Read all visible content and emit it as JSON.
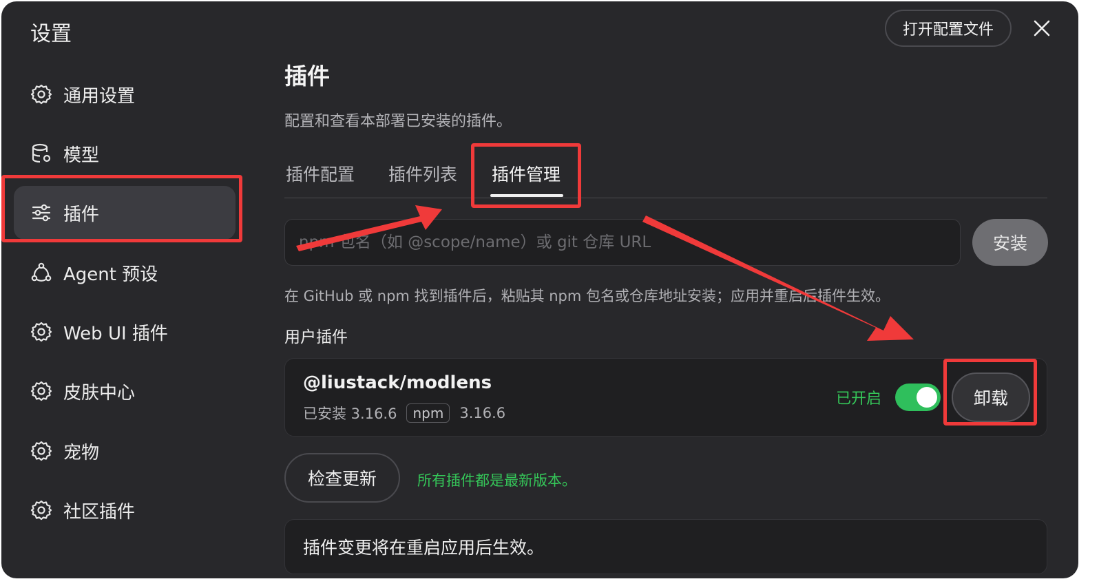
{
  "window": {
    "title": "设置",
    "open_config_label": "打开配置文件",
    "close_icon": "close-icon"
  },
  "sidebar": {
    "items": [
      {
        "label": "通用设置",
        "icon": "gear-icon"
      },
      {
        "label": "模型",
        "icon": "database-gear-icon"
      },
      {
        "label": "插件",
        "icon": "sliders-icon",
        "active": true
      },
      {
        "label": "Agent 预设",
        "icon": "agent-network-icon"
      },
      {
        "label": "Web UI 插件",
        "icon": "gear-icon"
      },
      {
        "label": "皮肤中心",
        "icon": "gear-icon"
      },
      {
        "label": "宠物",
        "icon": "gear-icon"
      },
      {
        "label": "社区插件",
        "icon": "gear-icon"
      }
    ]
  },
  "main": {
    "title": "插件",
    "description": "配置和查看本部署已安装的插件。",
    "tabs": [
      {
        "label": "插件配置"
      },
      {
        "label": "插件列表"
      },
      {
        "label": "插件管理",
        "active": true
      }
    ],
    "install": {
      "placeholder": "npm 包名（如 @scope/name）或 git 仓库 URL",
      "button_label": "安装",
      "hint": "在 GitHub 或 npm 找到插件后，粘贴其 npm 包名或仓库地址安装；应用并重启后插件生效。"
    },
    "user_plugins": {
      "section_title": "用户插件",
      "items": [
        {
          "name": "@liustack/modlens",
          "installed_label": "已安装 3.16.6",
          "source_badge": "npm",
          "latest_version": "3.16.6",
          "status": "已开启",
          "enabled": true,
          "uninstall_label": "卸载"
        }
      ]
    },
    "check_update_label": "检查更新",
    "update_status": "所有插件都是最新版本。",
    "notice": "插件变更将在重启应用后生效。"
  },
  "colors": {
    "background": "#28282b",
    "accent_green": "#35c759",
    "annotation_red": "#f03a3a"
  }
}
